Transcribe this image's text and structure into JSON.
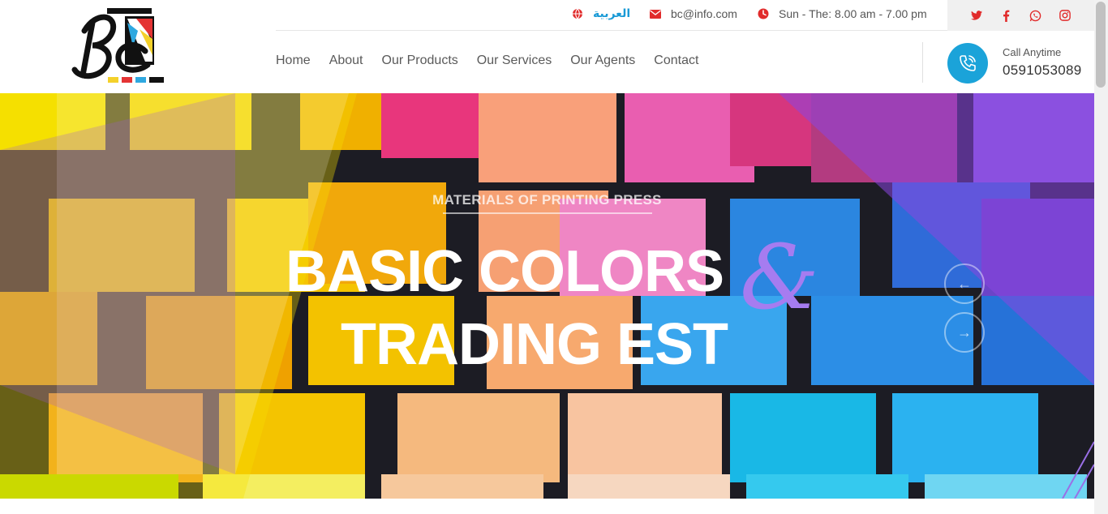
{
  "brand": {
    "logo_text": "BC"
  },
  "topbar": {
    "language": "العربية",
    "email": "bc@info.com",
    "hours": "Sun - The: 8.00 am - 7.00 pm",
    "social": [
      "twitter-icon",
      "facebook-icon",
      "whatsapp-icon",
      "instagram-icon"
    ]
  },
  "nav": {
    "items": [
      {
        "label": "Home"
      },
      {
        "label": "About"
      },
      {
        "label": "Our Products"
      },
      {
        "label": "Our Services"
      },
      {
        "label": "Our Agents"
      },
      {
        "label": "Contact"
      }
    ]
  },
  "call": {
    "label": "Call Anytime",
    "number": "0591053089"
  },
  "hero": {
    "subtitle": "MATERIALS OF PRINTING PRESS",
    "title_line1": "BASIC COLORS",
    "ampersand": "&",
    "title_line2": "TRADING EST",
    "prev_arrow": "←",
    "next_arrow": "→"
  },
  "colors": {
    "accent": "#1ba3d9",
    "icon_red": "#e12b2b",
    "ampersand": "#a67cf0"
  }
}
